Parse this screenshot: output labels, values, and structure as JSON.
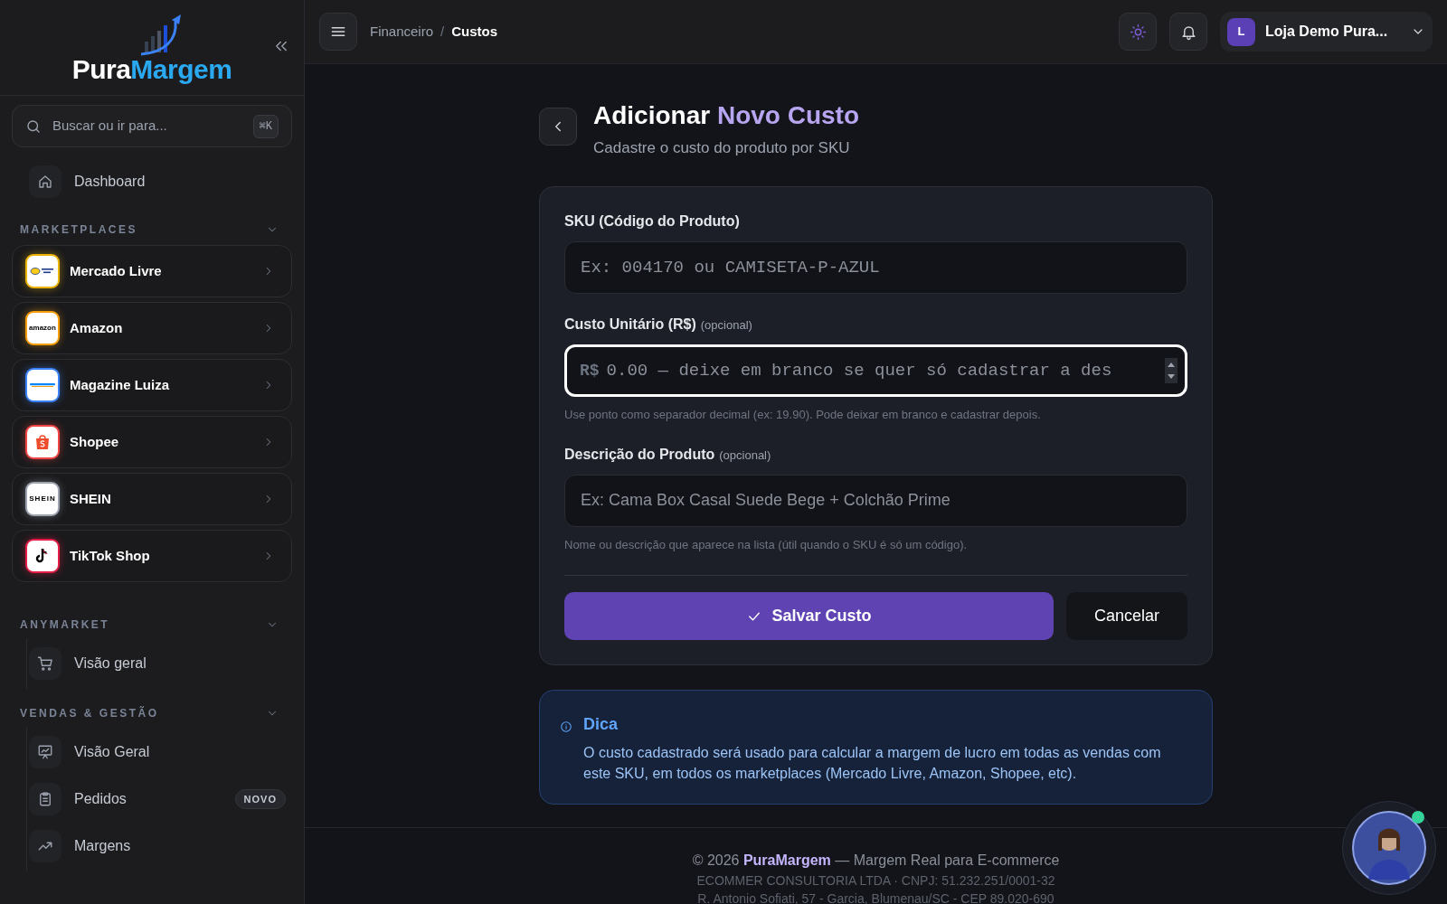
{
  "sidebar": {
    "logo": {
      "part_1": "Pura",
      "part_2": "Margem"
    },
    "search": {
      "placeholder": "Buscar ou ir para...",
      "shortcut": "⌘K"
    },
    "items": [
      {
        "label": "Dashboard"
      }
    ],
    "sections": [
      {
        "title": "MARKETPLACES",
        "expanded": true,
        "kind": "marketplaces",
        "items": [
          {
            "label": "Mercado Livre",
            "color": "#eab308"
          },
          {
            "label": "Amazon",
            "logo_text": "amazon",
            "color": "#f59e0b"
          },
          {
            "label": "Magazine Luiza",
            "color": "#3b82f6"
          },
          {
            "label": "Shopee",
            "color": "#ef4444"
          },
          {
            "label": "SHEIN",
            "logo_text": "SHEIN",
            "color": "#9ca3af"
          },
          {
            "label": "TikTok Shop",
            "color": "#e11d48"
          }
        ]
      },
      {
        "title": "ANYMARKET",
        "expanded": true,
        "kind": "links",
        "items": [
          {
            "label": "Visão geral"
          }
        ]
      },
      {
        "title": "VENDAS & GESTÃO",
        "expanded": true,
        "kind": "links",
        "items": [
          {
            "label": "Visão Geral"
          },
          {
            "label": "Pedidos",
            "badge": "NOVO"
          },
          {
            "label": "Margens"
          }
        ]
      }
    ]
  },
  "header": {
    "separator": "/",
    "breadcrumb": [
      {
        "label": "Financeiro",
        "current": false
      },
      {
        "label": "Custos",
        "current": true
      }
    ],
    "account": {
      "initial": "L",
      "name": "Loja Demo Pura..."
    }
  },
  "page": {
    "title": {
      "lead": "Adicionar",
      "accent": "Novo Custo"
    },
    "subtitle": "Cadastre o custo do produto por SKU"
  },
  "form": {
    "fields": [
      {
        "label": "SKU (Código do Produto)",
        "placeholder": "Ex: 004170 ou CAMISETA-P-AZUL",
        "kind": "code",
        "focused": false
      },
      {
        "label": "Custo Unitário (R$)",
        "optional": "(opcional)",
        "prefix": "R$",
        "placeholder": "0.00 — deixe em branco se quer só cadastrar a des",
        "kind": "number",
        "focused": true,
        "help": "Use ponto como separador decimal (ex: 19.90). Pode deixar em branco e cadastrar depois."
      },
      {
        "label": "Descrição do Produto",
        "optional": "(opcional)",
        "placeholder": "Ex: Cama Box Casal Suede Bege + Colchão Prime",
        "kind": "text",
        "focused": false,
        "help": "Nome ou descrição que aparece na lista (útil quando o SKU é só um código)."
      }
    ],
    "buttons": [
      {
        "label": "Salvar Custo",
        "kind": "primary"
      },
      {
        "label": "Cancelar",
        "kind": "secondary"
      }
    ]
  },
  "tip": {
    "title": "Dica",
    "text": "O custo cadastrado será usado para calcular a margem de lucro em todas as vendas com este SKU, em todos os marketplaces (Mercado Livre, Amazon, Shopee, etc)."
  },
  "footer": {
    "lines": [
      "© 2026 **PuraMargem** — Margem Real para E-commerce",
      "ECOMMER CONSULTORIA LTDA · CNPJ: 51.232.251/0001-32",
      "R. Antonio Sofiati, 57 - Garcia, Blumenau/SC - CEP 89.020-690"
    ]
  },
  "assistant": {
    "online": true
  }
}
